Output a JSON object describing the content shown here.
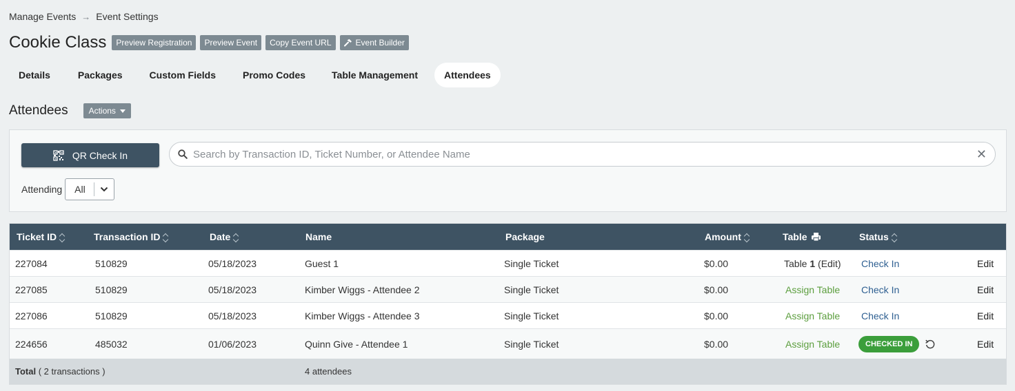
{
  "breadcrumb": {
    "parent": "Manage Events",
    "arrow": "→",
    "current": "Event Settings"
  },
  "title": "Cookie Class",
  "header_buttons": {
    "preview_registration": "Preview Registration",
    "preview_event": "Preview Event",
    "copy_event_url": "Copy Event URL",
    "event_builder": "Event Builder"
  },
  "tabs": [
    {
      "label": "Details"
    },
    {
      "label": "Packages"
    },
    {
      "label": "Custom Fields"
    },
    {
      "label": "Promo Codes"
    },
    {
      "label": "Table Management"
    },
    {
      "label": "Attendees",
      "active": true
    }
  ],
  "section": {
    "title": "Attendees",
    "actions_label": "Actions"
  },
  "qr_button": {
    "label": "QR Check In"
  },
  "search": {
    "placeholder": "Search by Transaction ID, Ticket Number, or Attendee Name",
    "value": ""
  },
  "filter": {
    "label": "Attending",
    "selected": "All"
  },
  "table": {
    "headers": {
      "ticket_id": "Ticket ID",
      "transaction_id": "Transaction ID",
      "date": "Date",
      "name": "Name",
      "package": "Package",
      "amount": "Amount",
      "table": "Table",
      "status": "Status"
    },
    "rows": [
      {
        "ticket_id": "227084",
        "transaction_id": "510829",
        "date": "05/18/2023",
        "name": "Guest 1",
        "package": "Single Ticket",
        "amount": "$0.00",
        "table_prefix": "Table ",
        "table_num": "1",
        "table_suffix": " (Edit)",
        "status": "Check In",
        "edit": "Edit"
      },
      {
        "ticket_id": "227085",
        "transaction_id": "510829",
        "date": "05/18/2023",
        "name": "Kimber Wiggs - Attendee 2",
        "package": "Single Ticket",
        "amount": "$0.00",
        "table": "Assign Table",
        "status": "Check In",
        "edit": "Edit"
      },
      {
        "ticket_id": "227086",
        "transaction_id": "510829",
        "date": "05/18/2023",
        "name": "Kimber Wiggs - Attendee 3",
        "package": "Single Ticket",
        "amount": "$0.00",
        "table": "Assign Table",
        "status": "Check In",
        "edit": "Edit"
      },
      {
        "ticket_id": "224656",
        "transaction_id": "485032",
        "date": "01/06/2023",
        "name": "Quinn Give - Attendee 1",
        "package": "Single Ticket",
        "amount": "$0.00",
        "table": "Assign Table",
        "status": "CHECKED IN",
        "edit": "Edit"
      }
    ],
    "footer": {
      "total_label": "Total",
      "total_detail": "( 2 transactions )",
      "attendees": "4 attendees"
    }
  },
  "colors": {
    "header_bg": "#3e5363",
    "page_bg": "#edf0f1",
    "grey_button": "#7d8a92",
    "green": "#5c9e3e",
    "blue_link": "#2e5f91",
    "badge_green": "#3b9e3b"
  },
  "icons": [
    "arrow-right-icon",
    "hammer-icon",
    "caret-down-icon",
    "qr-code-icon",
    "search-icon",
    "close-icon",
    "chevron-down-icon",
    "sort-icon",
    "printer-icon",
    "undo-icon"
  ]
}
